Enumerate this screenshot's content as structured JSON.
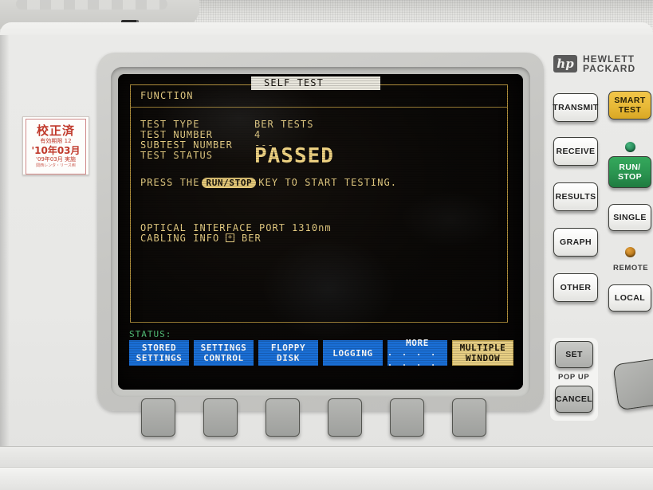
{
  "brand": {
    "logo_letters": "hp",
    "name_line1": "HEWLETT",
    "name_line2": "PACKARD"
  },
  "calibration_sticker": {
    "line1": "校正済",
    "line2": "有効期限 12",
    "line3": "'10年03月",
    "line4": "'09年03月 実施",
    "line5": "関西レンタ・リース㈱"
  },
  "screen": {
    "function_label": "FUNCTION",
    "function_value": "SELF TEST",
    "fields": [
      {
        "label": "TEST TYPE",
        "value": "BER TESTS"
      },
      {
        "label": "TEST NUMBER",
        "value": "4"
      },
      {
        "label": "SUBTEST NUMBER",
        "value": "---"
      },
      {
        "label": "TEST STATUS",
        "value": "PASSED"
      }
    ],
    "instruction": {
      "prefix": "PRESS THE",
      "key": "RUN/STOP",
      "suffix": "KEY TO START TESTING."
    },
    "optical": {
      "label": "OPTICAL INTERFACE PORT",
      "value": "1310nm"
    },
    "cabling": {
      "label": "CABLING INFO",
      "expand_glyph": "+",
      "value": "BER"
    },
    "status_word": "STATUS:",
    "softkeys": [
      {
        "line1": "STORED",
        "line2": "SETTINGS",
        "style": "blue"
      },
      {
        "line1": "SETTINGS",
        "line2": "CONTROL",
        "style": "blue"
      },
      {
        "line1": "FLOPPY",
        "line2": "DISK",
        "style": "blue"
      },
      {
        "line1": "LOGGING",
        "line2": "",
        "style": "blue"
      },
      {
        "line1": "MORE",
        "line2": ". . . . . . . .",
        "style": "blue"
      },
      {
        "line1": "MULTIPLE",
        "line2": "WINDOW",
        "style": "yellow"
      }
    ]
  },
  "right_panel": {
    "keys_left_column": [
      "TRANSMIT",
      "RECEIVE",
      "RESULTS",
      "GRAPH",
      "OTHER"
    ],
    "smart_test": {
      "line1": "SMART",
      "line2": "TEST"
    },
    "run_stop": {
      "line1": "RUN/",
      "line2": "STOP"
    },
    "single": "SINGLE",
    "remote_label": "REMOTE",
    "local": "LOCAL",
    "set": "SET",
    "popup_label": "POP UP",
    "cancel": "CANCEL"
  },
  "colors": {
    "crt_amber": "#e8cf84",
    "softkey_blue": "#1a6fd6",
    "softkey_yellow": "#e8cf84",
    "status_green": "#55c27a",
    "run_green": "#2a9450",
    "smart_yellow": "#e8b937"
  }
}
